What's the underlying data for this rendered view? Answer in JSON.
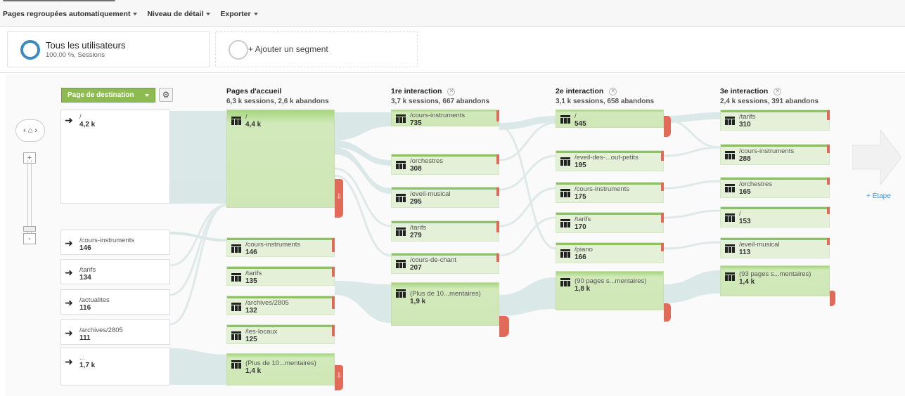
{
  "toolbar": {
    "items": [
      "Pages regroupées automatiquement",
      "Niveau de détail",
      "Exporter"
    ]
  },
  "segments": {
    "active": {
      "title": "Tous les utilisateurs",
      "sub": "100,00 %, Sessions"
    },
    "add": {
      "title": "+ Ajouter un segment"
    }
  },
  "controls": {
    "dimension": "Page de destination",
    "zoom_in": "+",
    "zoom_out": "-",
    "step": "+ Étape"
  },
  "columns": [
    {
      "title": "Pages d'accueil",
      "sub": "6,3 k sessions, 2,6 k abandons"
    },
    {
      "title": "1re interaction",
      "sub": "3,7 k sessions, 667 abandons"
    },
    {
      "title": "2e interaction",
      "sub": "3,1 k sessions, 658 abandons"
    },
    {
      "title": "3e interaction",
      "sub": "2,4 k sessions, 391 abandons"
    }
  ],
  "landing": [
    {
      "name": "/",
      "val": "4,2 k"
    },
    {
      "name": "/cours-instruments",
      "val": "146"
    },
    {
      "name": "/tarifs",
      "val": "134"
    },
    {
      "name": "/actualites",
      "val": "116"
    },
    {
      "name": "/archives/2805",
      "val": "111"
    },
    {
      "name": "...",
      "val": "1,7 k"
    }
  ],
  "accueil": [
    {
      "name": "/",
      "val": "4,4 k"
    },
    {
      "name": "/cours-instruments",
      "val": "146"
    },
    {
      "name": "/tarifs",
      "val": "135"
    },
    {
      "name": "/archives/2805",
      "val": "132"
    },
    {
      "name": "/les-locaux",
      "val": "125"
    },
    {
      "name": "(Plus de 10...mentaires)",
      "val": "1,4 k"
    }
  ],
  "int1": [
    {
      "name": "/cours-instruments",
      "val": "735"
    },
    {
      "name": "/orchestres",
      "val": "308"
    },
    {
      "name": "/eveil-musical",
      "val": "295"
    },
    {
      "name": "/tarifs",
      "val": "279"
    },
    {
      "name": "/cours-de-chant",
      "val": "207"
    },
    {
      "name": "(Plus de 10...mentaires)",
      "val": "1,9 k"
    }
  ],
  "int2": [
    {
      "name": "/",
      "val": "545"
    },
    {
      "name": "/eveil-des-...out-petits",
      "val": "195"
    },
    {
      "name": "/cours-instruments",
      "val": "175"
    },
    {
      "name": "/tarifs",
      "val": "170"
    },
    {
      "name": "/piano",
      "val": "166"
    },
    {
      "name": "(90 pages s...mentaires)",
      "val": "1,8 k"
    }
  ],
  "int3": [
    {
      "name": "/tarifs",
      "val": "310"
    },
    {
      "name": "/cours-instruments",
      "val": "288"
    },
    {
      "name": "/orchestres",
      "val": "165"
    },
    {
      "name": "/",
      "val": "153"
    },
    {
      "name": "/eveil-musical",
      "val": "113"
    },
    {
      "name": "(93 pages s...mentaires)",
      "val": "1,4 k"
    }
  ]
}
